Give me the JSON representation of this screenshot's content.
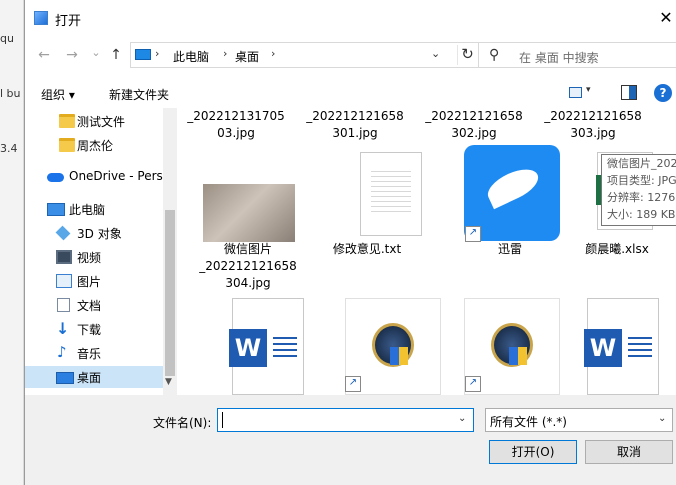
{
  "background_app": {
    "lines": [
      "qu",
      "l bu",
      "3.4"
    ]
  },
  "dialog": {
    "title": "打开",
    "close": "✕"
  },
  "nav": {
    "back": "←",
    "forward": "→",
    "recent": "⌄",
    "up": "↑",
    "address": [
      "此电脑",
      "桌面"
    ],
    "search_placeholder": "在 桌面 中搜索"
  },
  "toolbar": {
    "organize": "组织 ▾",
    "new_folder": "新建文件夹",
    "help": "?"
  },
  "sidebar": {
    "items": [
      {
        "label": "测试文件",
        "icon": "folder-icon"
      },
      {
        "label": "周杰伦",
        "icon": "folder-icon"
      },
      {
        "label": "OneDrive - Perso",
        "icon": "cloud-icon"
      },
      {
        "label": "此电脑",
        "icon": "computer-icon"
      },
      {
        "label": "3D 对象",
        "icon": "cube-icon"
      },
      {
        "label": "视频",
        "icon": "video-icon"
      },
      {
        "label": "图片",
        "icon": "picture-icon"
      },
      {
        "label": "文档",
        "icon": "document-icon"
      },
      {
        "label": "下载",
        "icon": "download-icon"
      },
      {
        "label": "音乐",
        "icon": "music-icon"
      },
      {
        "label": "桌面",
        "icon": "desktop-icon",
        "selected": true
      }
    ]
  },
  "files": {
    "row0": [
      "_202212131705\n03.jpg",
      "_202212121658\n301.jpg",
      "_202212121658\n302.jpg",
      "_202212121658\n303.jpg"
    ],
    "row1": [
      "微信图片\n_202212121658\n304.jpg",
      "修改意见.txt",
      "迅雷",
      "颜晨曦.xlsx"
    ],
    "row2_icons": [
      "word-icon",
      "lol-icon",
      "lol-icon",
      "word-icon"
    ]
  },
  "tooltip": {
    "lines": [
      "微信图片_202",
      "项目类型: JPG",
      "分辨率: 1276",
      "大小: 189 KB"
    ]
  },
  "bottom": {
    "filename_label": "文件名(N):",
    "filename_value": "",
    "filetype": "所有文件 (*.*)",
    "open": "打开(O)",
    "cancel": "取消"
  }
}
